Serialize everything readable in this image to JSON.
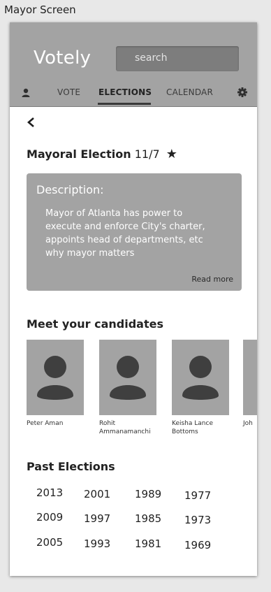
{
  "screen_label": "Mayor Screen",
  "app": {
    "title": "Votely",
    "search_placeholder": "search"
  },
  "nav": {
    "items": [
      {
        "label": "VOTE"
      },
      {
        "label": "ELECTIONS",
        "active": true
      },
      {
        "label": "CALENDAR"
      }
    ]
  },
  "election": {
    "title": "Mayoral Election",
    "date": "11/7",
    "starred": true,
    "star_glyph": "★"
  },
  "description": {
    "title": "Description:",
    "body": "Mayor of Atlanta has power to execute and enforce City's charter, appoints head of departments, etc why mayor matters",
    "read_more": "Read more"
  },
  "candidates": {
    "heading": "Meet your candidates",
    "list": [
      {
        "name": "Peter Aman"
      },
      {
        "name": "Rohit Ammanamanchi"
      },
      {
        "name": "Keisha Lance Bottoms"
      },
      {
        "name": "Joh"
      }
    ]
  },
  "past_elections": {
    "heading": "Past Elections",
    "years": [
      [
        "2013",
        "2001",
        "1989",
        "1977"
      ],
      [
        "2009",
        "1997",
        "1985",
        "1973"
      ],
      [
        "2005",
        "1993",
        "1981",
        "1969"
      ]
    ]
  },
  "colors": {
    "header_bg": "#a3a3a3",
    "search_bg": "#7d7d7d",
    "card_bg": "#a3a3a3",
    "avatar": "#3f3f3f"
  }
}
